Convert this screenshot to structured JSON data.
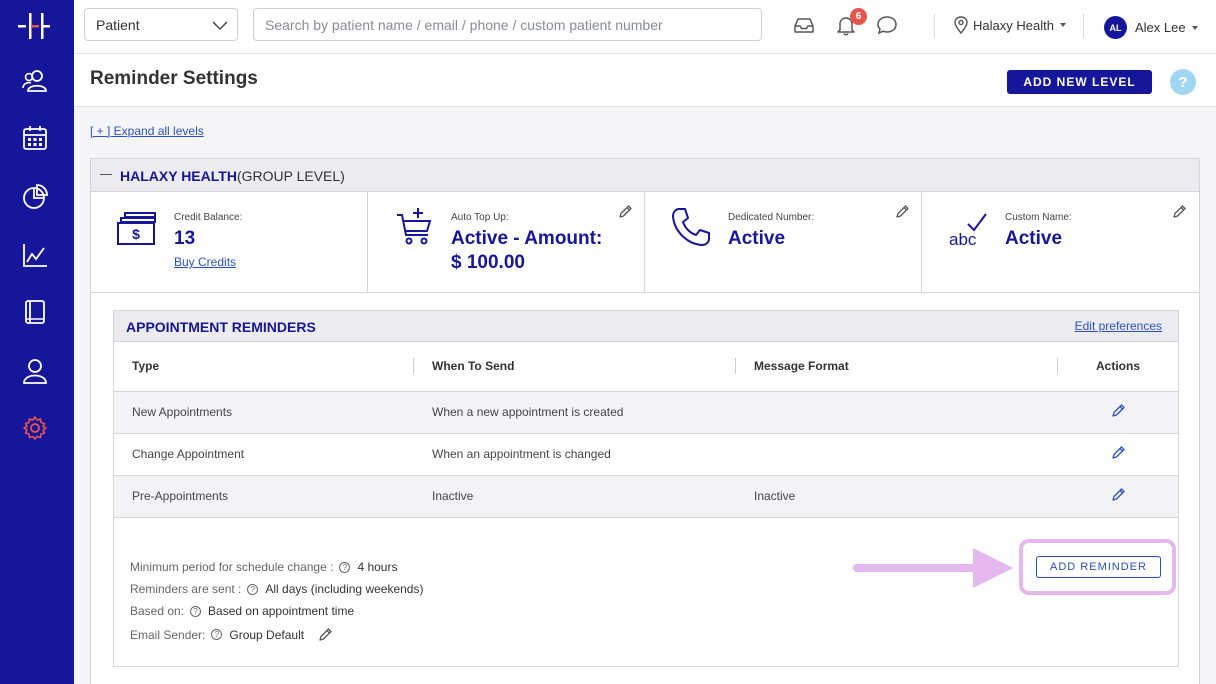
{
  "topbar": {
    "search_type": "Patient",
    "search_placeholder": "Search by patient name / email / phone / custom patient number",
    "notification_count": "6",
    "organization": "Halaxy Health",
    "user_initials": "AL",
    "user_name": "Alex Lee"
  },
  "sidebar": {
    "items": [
      {
        "icon": "patients-icon"
      },
      {
        "icon": "calendar-icon"
      },
      {
        "icon": "reports-pie-icon"
      },
      {
        "icon": "analytics-chart-icon"
      },
      {
        "icon": "book-icon"
      },
      {
        "icon": "user-icon"
      },
      {
        "icon": "settings-gear-icon",
        "active": true
      }
    ],
    "accent_active": "#e8554d",
    "background": "#16169a"
  },
  "page": {
    "title": "Reminder Settings",
    "add_level_label": "ADD NEW LEVEL",
    "help_label": "?",
    "expand_link": "[ + ] Expand all levels"
  },
  "group": {
    "name": "HALAXY HEALTH",
    "level": "(GROUP LEVEL)",
    "cards": {
      "credit": {
        "label": "Credit Balance:",
        "value": "13",
        "link": "Buy Credits"
      },
      "topup": {
        "label": "Auto Top Up:",
        "value_line1": "Active - Amount:",
        "value_line2": "$ 100.00"
      },
      "number": {
        "label": "Dedicated Number:",
        "value": "Active"
      },
      "custom": {
        "label": "Custom Name:",
        "value": "Active"
      }
    }
  },
  "appointment_reminders": {
    "title": "APPOINTMENT REMINDERS",
    "edit_link": "Edit preferences",
    "columns": [
      "Type",
      "When To Send",
      "Message Format",
      "Actions"
    ],
    "rows": [
      {
        "type": "New Appointments",
        "when": "When a new appointment is created",
        "format": ""
      },
      {
        "type": "Change Appointment",
        "when": "When an appointment is changed",
        "format": ""
      },
      {
        "type": "Pre-Appointments",
        "when": "Inactive",
        "format": "Inactive"
      }
    ],
    "settings": [
      {
        "label": "Minimum period for schedule change :",
        "value": "4 hours"
      },
      {
        "label": "Reminders are sent :",
        "value": "All days (including weekends)"
      },
      {
        "label": "Based on:",
        "value": "Based on appointment time"
      },
      {
        "label": "Email Sender:",
        "value": "Group Default"
      }
    ],
    "add_reminder_label": "ADD REMINDER"
  }
}
